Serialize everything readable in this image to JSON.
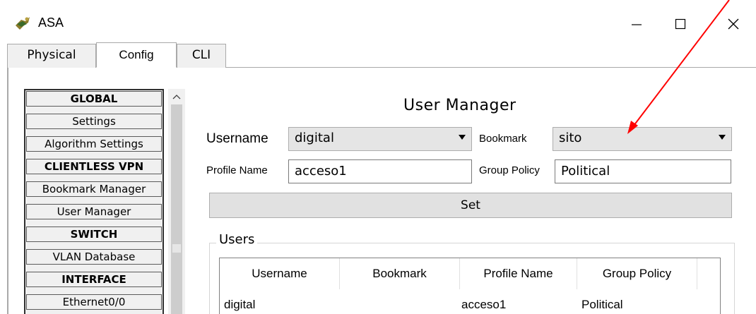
{
  "window": {
    "title": "ASA",
    "controls": {
      "minimize": "minimize",
      "maximize": "maximize",
      "close": "close"
    }
  },
  "tabs": [
    {
      "label": "Physical"
    },
    {
      "label": "Config",
      "selected": true
    },
    {
      "label": "CLI"
    }
  ],
  "sidebar": {
    "items": [
      {
        "label": "GLOBAL",
        "header": true
      },
      {
        "label": "Settings"
      },
      {
        "label": "Algorithm Settings"
      },
      {
        "label": "CLIENTLESS VPN",
        "header": true
      },
      {
        "label": "Bookmark Manager"
      },
      {
        "label": "User Manager"
      },
      {
        "label": "SWITCH",
        "header": true
      },
      {
        "label": "VLAN Database"
      },
      {
        "label": "INTERFACE",
        "header": true
      },
      {
        "label": "Ethernet0/0"
      }
    ]
  },
  "main": {
    "title": "User Manager",
    "username_label": "Username",
    "username_value": "digital",
    "bookmark_label": "Bookmark",
    "bookmark_value": "sito",
    "profile_label": "Profile Name",
    "profile_value": "acceso1",
    "group_label": "Group Policy",
    "group_value": "Political",
    "set_label": "Set",
    "users_legend": "Users",
    "users_table": {
      "columns": [
        "Username",
        "Bookmark",
        "Profile Name",
        "Group Policy"
      ],
      "rows": [
        [
          "digital",
          "",
          "acceso1",
          "Political"
        ]
      ]
    }
  },
  "colors": {
    "annotation_arrow": "#ff0000"
  }
}
